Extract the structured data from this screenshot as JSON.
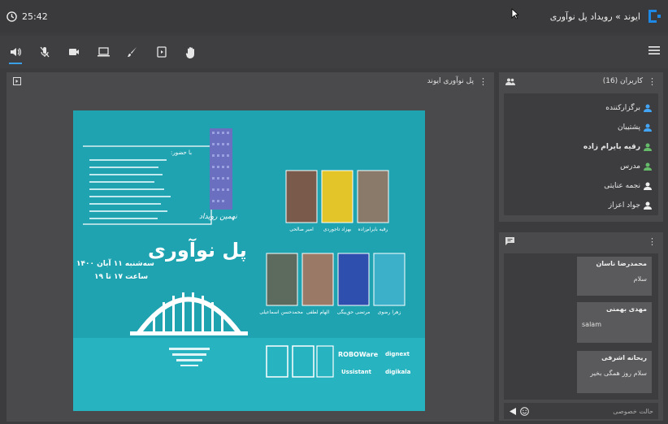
{
  "topbar": {
    "timer": "25:42",
    "title": "ایوند » رویداد پل نوآوری",
    "logo_color": "#1e88e5"
  },
  "toolbar": {
    "tools": [
      "speaker-icon",
      "mic-off-icon",
      "camera-icon",
      "screen-share-icon",
      "brush-icon",
      "slides-icon",
      "hand-icon"
    ],
    "active_tool": "speaker-icon",
    "menu": "menu-icon"
  },
  "main_panel": {
    "title": "پل نوآوری ایوند"
  },
  "slide": {
    "attendees_heading": "با حضور:",
    "event_small": "نهمین رویداد",
    "event_title": "پل نوآوری",
    "date_line": "سه‌شنبه ۱۱ آبان ۱۴۰۰",
    "time_line": "ساعت ۱۷ تا ۱۹",
    "speakers_top": [
      "رقیه بایرام‌زاده",
      "بهزاد تاجوردی",
      "امیر صالحی"
    ],
    "speakers_bottom": [
      "زهرا رضوی",
      "مرتضی حق‌بیگی",
      "الهام لطفی",
      "محمدحسن اسماعیلی"
    ],
    "sponsors": [
      "ROBOWare",
      "dignext",
      "Ussistant",
      "digikala"
    ],
    "bg_color": "#1fa3b1"
  },
  "users_panel": {
    "title": "کاربران (16)",
    "users": [
      {
        "name": "برگزارکننده",
        "color": "#42a5f5",
        "bold": false
      },
      {
        "name": "پشتیبان",
        "color": "#42a5f5",
        "bold": false
      },
      {
        "name": "رقیه بایرام زاده",
        "color": "#66bb6a",
        "bold": true
      },
      {
        "name": "مدرس",
        "color": "#66bb6a",
        "bold": false
      },
      {
        "name": "نجمه عنایتی",
        "color": "#eeeeee",
        "bold": false
      },
      {
        "name": "جواد اعزاز",
        "color": "#eeeeee",
        "bold": false
      }
    ]
  },
  "chat_panel": {
    "messages": [
      {
        "name": "محمدرضا ناسان",
        "text": "سلام"
      },
      {
        "name": "مهدی بهمنی",
        "text": "salam"
      },
      {
        "name": "ریحانه اشرفی",
        "text": "سلام روز همگی بخیر"
      }
    ],
    "input_placeholder": "حالت خصوصی"
  }
}
